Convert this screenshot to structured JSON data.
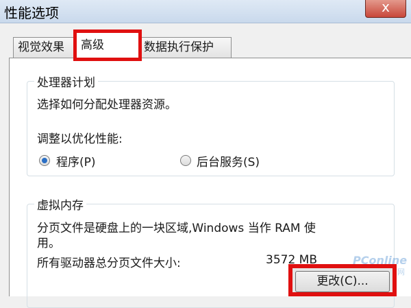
{
  "window": {
    "title": "性能选项",
    "close_label": "x"
  },
  "tabs": [
    {
      "label": "视觉效果"
    },
    {
      "label": "高级"
    },
    {
      "label": "数据执行保护"
    }
  ],
  "processor": {
    "title": "处理器计划",
    "description": "选择如何分配处理器资源。",
    "adjust_label": "调整以优化性能:",
    "options": [
      {
        "label": "程序(P)",
        "checked": true
      },
      {
        "label": "后台服务(S)",
        "checked": false
      }
    ]
  },
  "virtual_memory": {
    "title": "虚拟内存",
    "description_line1": "分页文件是硬盘上的一块区域,Windows 当作 RAM 使",
    "description_line2": "用。",
    "total_label": "所有驱动器总分页文件大小:",
    "total_value": "3572 MB",
    "change_button": "更改(C)..."
  },
  "watermark": {
    "brand": "PConline",
    "sub": "太平洋电脑网"
  }
}
